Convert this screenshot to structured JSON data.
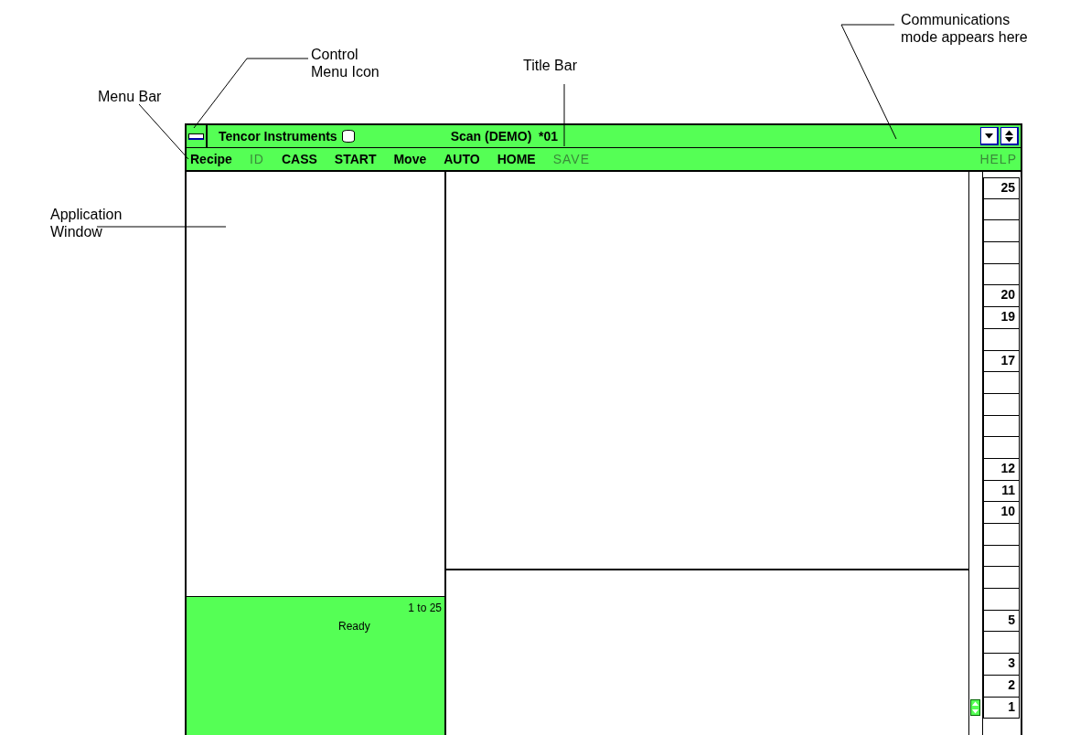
{
  "annotations": [
    {
      "text": "Control\nMenu Icon"
    },
    {
      "text": "Menu Bar"
    },
    {
      "text": "Title Bar"
    },
    {
      "text": "Communications\nmode appears here"
    },
    {
      "text": "Application\nWindow"
    }
  ],
  "window": {
    "app_name": "Tencor Instruments",
    "title": "Scan (DEMO)  *01"
  },
  "menu": [
    {
      "label": "Recipe",
      "disabled": false
    },
    {
      "label": "ID",
      "disabled": true
    },
    {
      "label": "CASS",
      "disabled": false
    },
    {
      "label": "START",
      "disabled": false
    },
    {
      "label": "Move",
      "disabled": false
    },
    {
      "label": "AUTO",
      "disabled": false
    },
    {
      "label": "HOME",
      "disabled": false
    },
    {
      "label": "SAVE",
      "disabled": true
    }
  ],
  "help": {
    "label": "HELP",
    "disabled": true
  },
  "status": {
    "range": "1 to 25",
    "message": "Ready"
  },
  "slots": [
    {
      "label": "25",
      "current": false
    },
    {
      "current": false
    },
    {
      "current": false
    },
    {
      "current": false
    },
    {
      "current": false
    },
    {
      "label": "20",
      "current": false
    },
    {
      "label": "19",
      "current": false
    },
    {
      "current": false
    },
    {
      "label": "17",
      "current": false
    },
    {
      "current": false
    },
    {
      "current": false
    },
    {
      "current": false
    },
    {
      "current": false
    },
    {
      "label": "12",
      "current": false
    },
    {
      "label": "11",
      "current": false
    },
    {
      "label": "10",
      "current": false
    },
    {
      "current": false
    },
    {
      "current": false
    },
    {
      "current": false
    },
    {
      "current": false
    },
    {
      "label": "5",
      "current": false
    },
    {
      "current": false
    },
    {
      "label": "3",
      "current": false
    },
    {
      "label": "2",
      "current": false
    },
    {
      "label": "1",
      "current": true
    }
  ]
}
